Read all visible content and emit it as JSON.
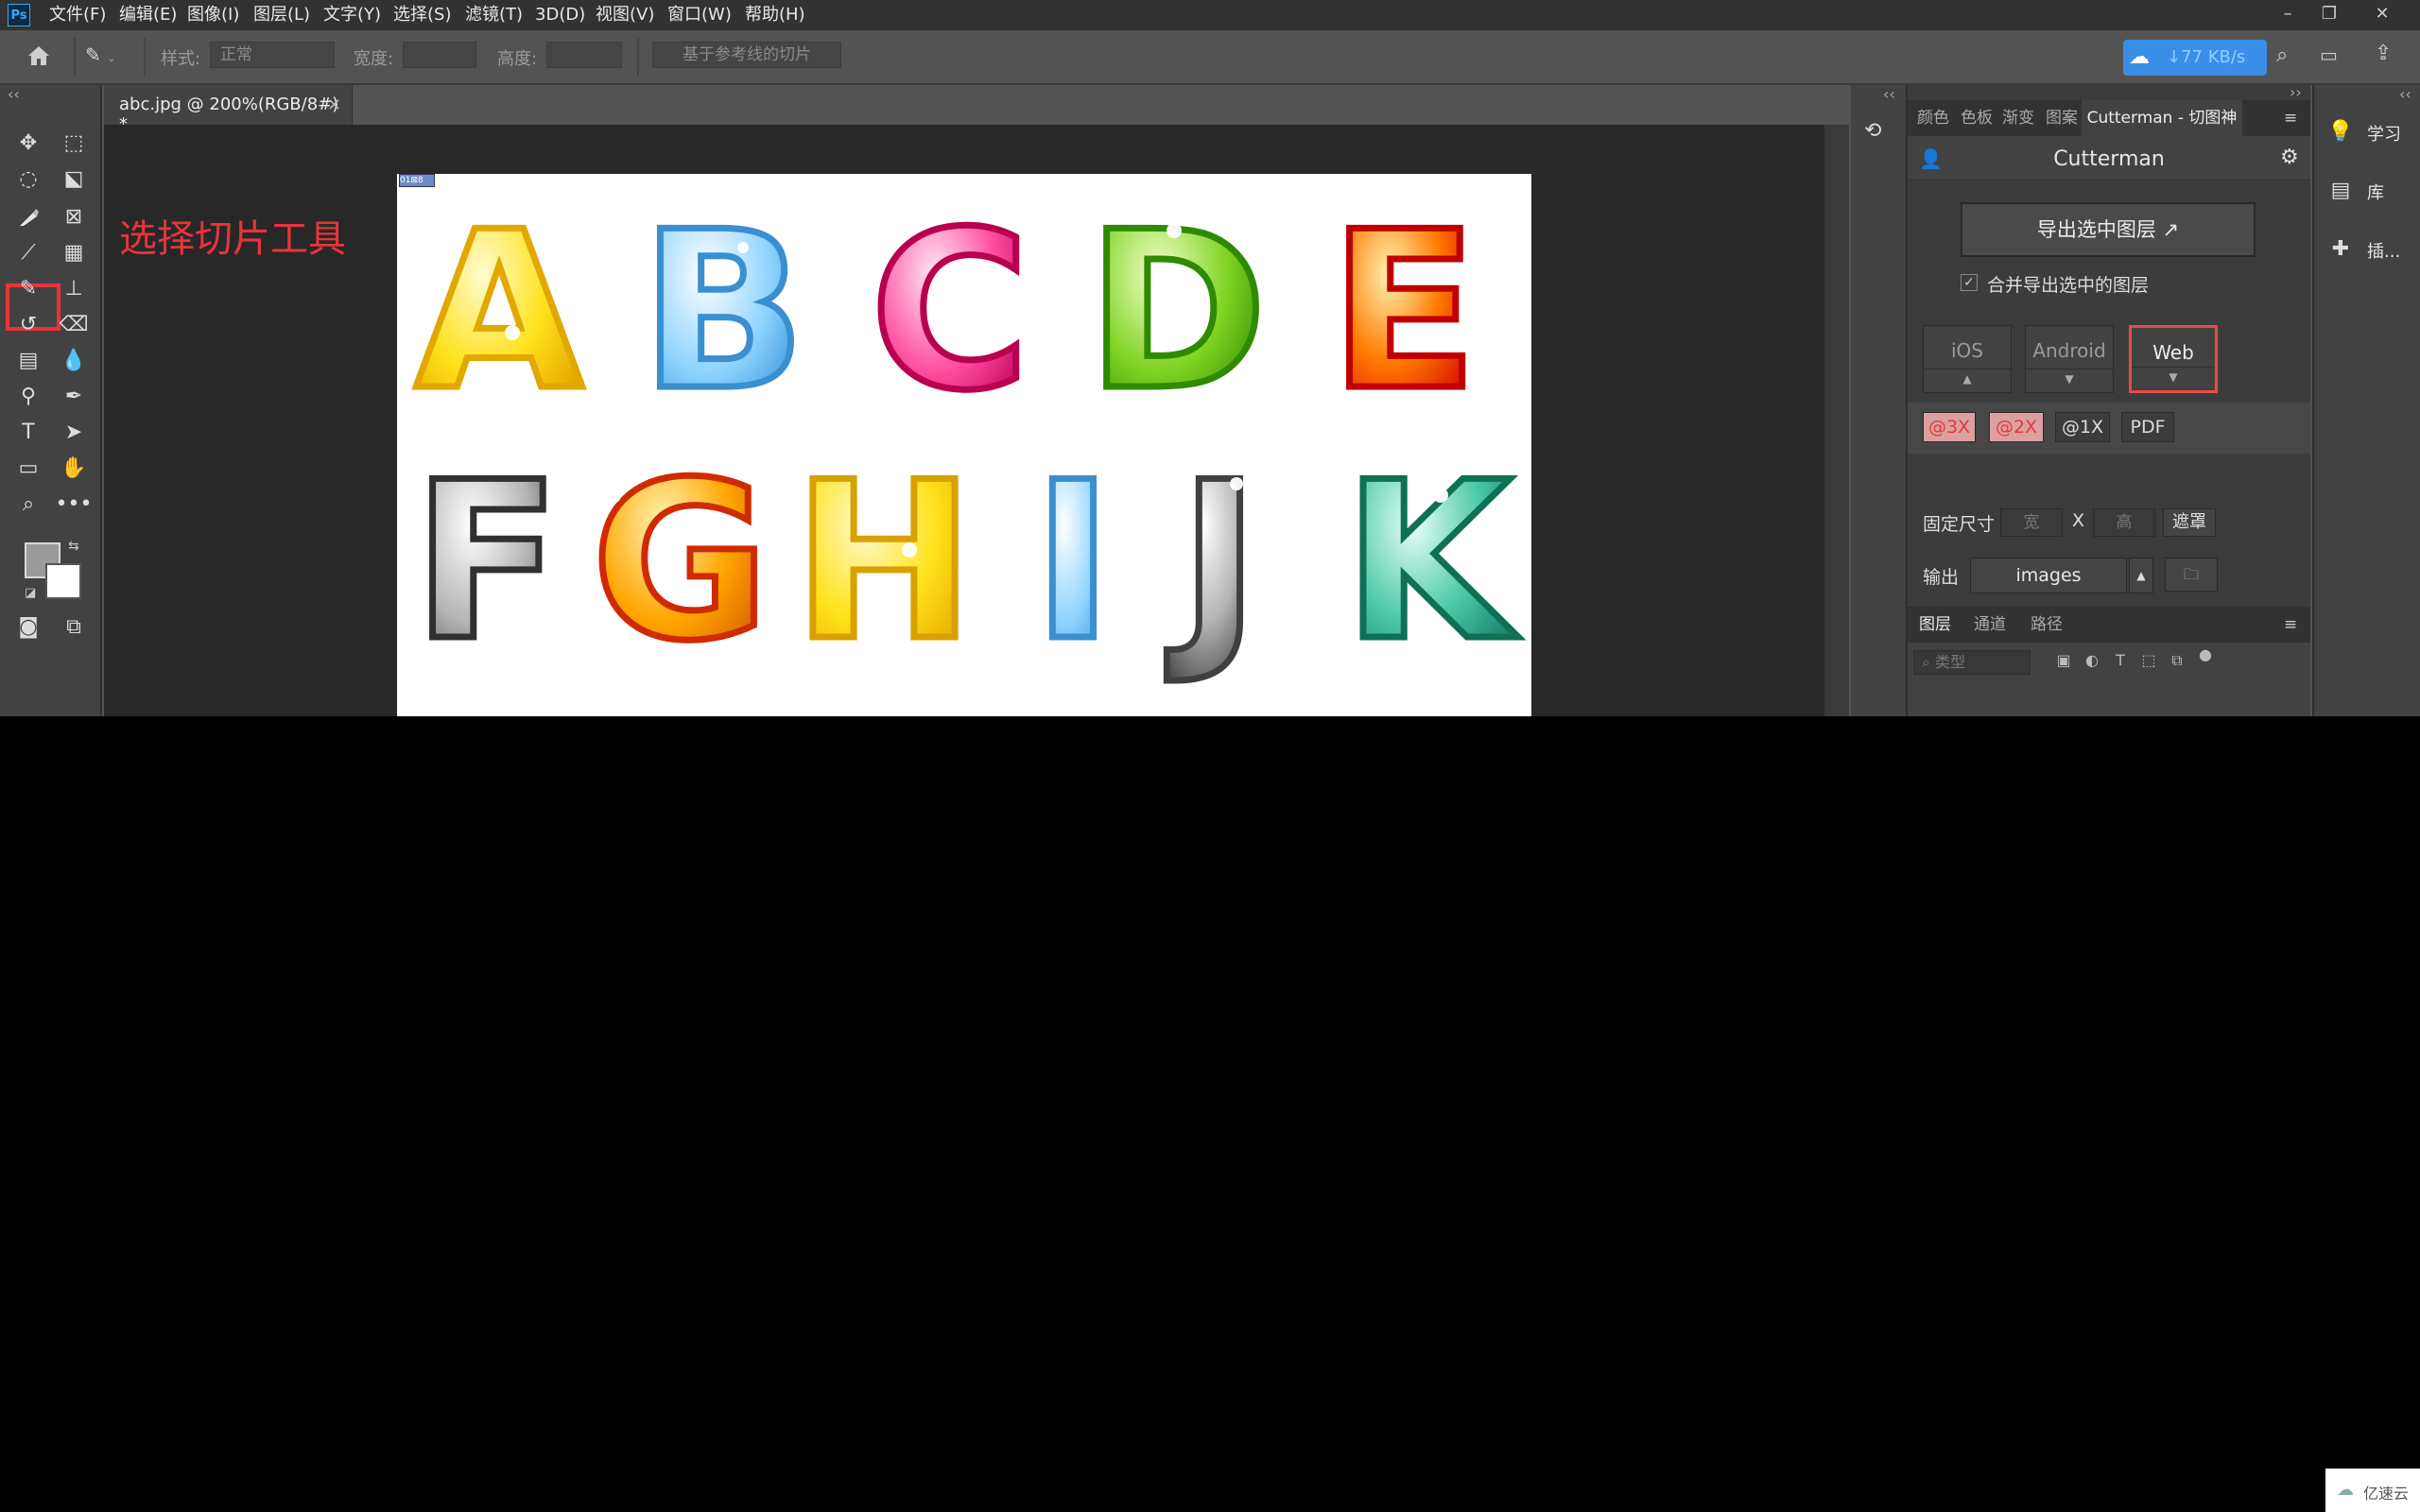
{
  "app": {
    "logo": "Ps"
  },
  "menu": [
    "文件(F)",
    "编辑(E)",
    "图像(I)",
    "图层(L)",
    "文字(Y)",
    "选择(S)",
    "滤镜(T)",
    "3D(D)",
    "视图(V)",
    "窗口(W)",
    "帮助(H)"
  ],
  "options": {
    "style_label": "样式:",
    "style_value": "正常",
    "width_label": "宽度:",
    "height_label": "高度:",
    "guides_button": "基于参考线的切片",
    "net_speed": "↓77 KB/s"
  },
  "document": {
    "tab_label": "abc.jpg @ 200%(RGB/8#) *",
    "close": "×",
    "slice_tag": "01⊠8"
  },
  "annotation": "选择切片工具",
  "panel": {
    "tabs": [
      "颜色",
      "色板",
      "渐变",
      "图案",
      "Cutterman - 切图神器"
    ],
    "cm_title": "Cutterman",
    "export_button": "导出选中图层",
    "merge_label": "合并导出选中的图层",
    "platforms": [
      "iOS",
      "Android",
      "Web"
    ],
    "scales": [
      "@3X",
      "@2X",
      "@1X",
      "PDF"
    ],
    "fixed_size_label": "固定尺寸",
    "width_ph": "宽",
    "x": "X",
    "height_ph": "高",
    "mask_button": "遮罩",
    "output_label": "输出",
    "output_value": "images",
    "layers_tabs": [
      "图层",
      "通道",
      "路径"
    ],
    "layer_search": "类型"
  },
  "side": [
    "学习",
    "库",
    "插..."
  ],
  "watermark": "亿速云",
  "colors": {
    "accent_red": "#e8343a",
    "ps_blue": "#31a8ff",
    "net_blue": "#3b8ee8"
  }
}
